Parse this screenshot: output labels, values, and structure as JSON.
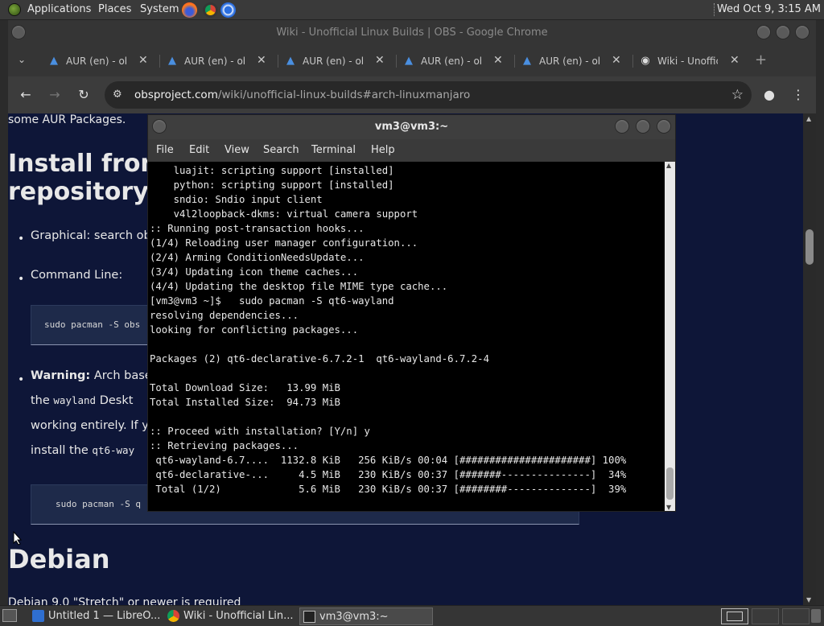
{
  "top_panel": {
    "menus": [
      "Applications",
      "Places",
      "System"
    ],
    "clock": "Wed Oct  9,  3:15 AM"
  },
  "chrome": {
    "window_title": "Wiki - Unofficial Linux Builds | OBS - Google Chrome",
    "tabs": [
      {
        "label": "AUR (en) - obs",
        "icon": "arch-icon"
      },
      {
        "label": "AUR (en) - obs",
        "icon": "arch-icon"
      },
      {
        "label": "AUR (en) - obs",
        "icon": "arch-icon"
      },
      {
        "label": "AUR (en) - obs",
        "icon": "arch-icon"
      },
      {
        "label": "AUR (en) - obs",
        "icon": "arch-icon"
      },
      {
        "label": "Wiki - Unofficial",
        "icon": "obs-icon"
      }
    ],
    "url_domain": "obsproject.com",
    "url_path": "/wiki/unofficial-linux-builds#arch-linuxmanjaro"
  },
  "page": {
    "intro_text": "some AUR Packages.",
    "heading_line1": "Install from",
    "heading_line2": "repository",
    "bullet_graphical": "Graphical: search ob",
    "bullet_cmdline": "Command Line:",
    "code1": "sudo pacman -S obs",
    "warning_label": "Warning:",
    "warning_text1": " Arch base",
    "warning_text2_pre": "the ",
    "warning_text2_code": "wayland",
    "warning_text2_post": " Deskt",
    "warning_text3": "working entirely. If y",
    "warning_text4_pre": "install the ",
    "warning_text4_code": "qt6-way",
    "code2": "sudo pacman -S q",
    "debian_heading": "Debian",
    "debian_text": "Debian 9.0 \"Stretch\" or newer is required"
  },
  "terminal": {
    "title": "vm3@vm3:~",
    "menus": [
      "File",
      "Edit",
      "View",
      "Search",
      "Terminal",
      "Help"
    ],
    "lines": [
      "    luajit: scripting support [installed]",
      "    python: scripting support [installed]",
      "    sndio: Sndio input client",
      "    v4l2loopback-dkms: virtual camera support",
      ":: Running post-transaction hooks...",
      "(1/4) Reloading user manager configuration...",
      "(2/4) Arming ConditionNeedsUpdate...",
      "(3/4) Updating icon theme caches...",
      "(4/4) Updating the desktop file MIME type cache...",
      "[vm3@vm3 ~]$   sudo pacman -S qt6-wayland",
      "resolving dependencies...",
      "looking for conflicting packages...",
      "",
      "Packages (2) qt6-declarative-6.7.2-1  qt6-wayland-6.7.2-4",
      "",
      "Total Download Size:   13.99 MiB",
      "Total Installed Size:  94.73 MiB",
      "",
      ":: Proceed with installation? [Y/n] y",
      ":: Retrieving packages...",
      " qt6-wayland-6.7....  1132.8 KiB   256 KiB/s 00:04 [######################] 100%",
      " qt6-declarative-...     4.5 MiB   230 KiB/s 00:37 [#######---------------]  34%",
      " Total (1/2)             5.6 MiB   230 KiB/s 00:37 [########--------------]  39%"
    ]
  },
  "taskbar": {
    "tasks": [
      {
        "label": "Untitled 1 — LibreO...",
        "icon": "libreoffice-writer-icon"
      },
      {
        "label": "Wiki - Unofficial Lin...",
        "icon": "chrome-icon"
      },
      {
        "label": "vm3@vm3:~",
        "icon": "terminal-icon"
      }
    ]
  },
  "colors": {
    "page_bg": "#0e1638",
    "terminal_bg": "#000000",
    "panel_bg": "#3a3a3a"
  }
}
